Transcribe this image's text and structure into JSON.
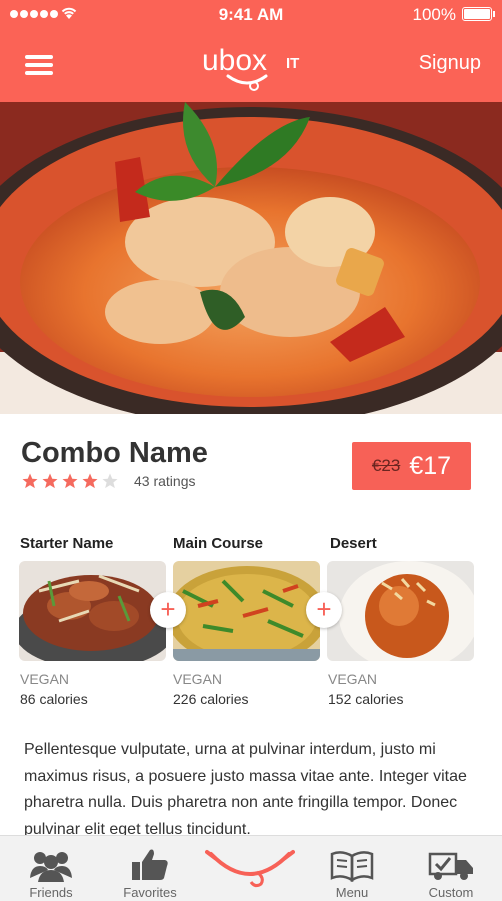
{
  "status_bar": {
    "time": "9:41 AM",
    "battery": "100%"
  },
  "header": {
    "logo_text": "uboxIT",
    "signup_label": "Signup"
  },
  "combo": {
    "name": "Combo Name",
    "rating": 4,
    "rating_max": 5,
    "ratings_count": "43 ratings",
    "old_price": "€23",
    "new_price": "€17"
  },
  "courses": [
    {
      "title": "Starter Name",
      "tag": "VEGAN",
      "calories": "86 calories"
    },
    {
      "title": "Main Course",
      "tag": "VEGAN",
      "calories": "226 calories"
    },
    {
      "title": "Desert",
      "tag": "VEGAN",
      "calories": "152 calories"
    }
  ],
  "description": "Pellentesque vulputate, urna at pulvinar interdum, justo mi maximus risus, a posuere justo massa vitae ante. Integer vitae pharetra nulla. Duis pharetra non ante fringilla tempor. Donec pulvinar elit eget tellus tincidunt.",
  "bottom_nav": {
    "friends": "Friends",
    "favorites": "Favorites",
    "menu": "Menu",
    "custom": "Custom"
  },
  "colors": {
    "accent": "#fb6356",
    "price_bg": "#f76157",
    "star": "#f56a5e"
  }
}
